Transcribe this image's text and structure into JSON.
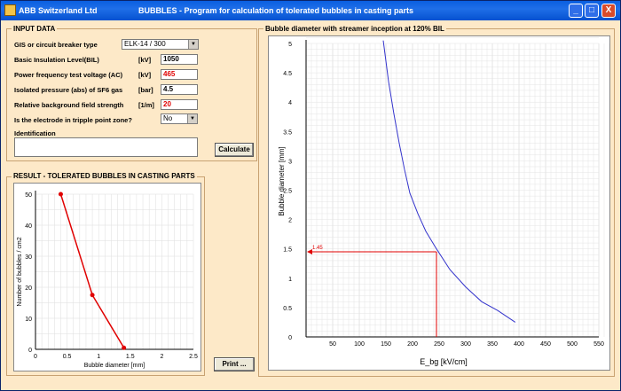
{
  "window": {
    "company": "ABB Switzerland Ltd",
    "title": "BUBBLES - Program for calculation of tolerated bubbles in casting parts",
    "minimize": "_",
    "maximize": "□",
    "close": "X"
  },
  "input": {
    "group_title": "INPUT DATA",
    "gis_label": "GIS or circuit breaker type",
    "gis_value": "ELK-14 / 300",
    "bil_label": "Basic Insulation Level(BIL)",
    "bil_unit": "[kV]",
    "bil_value": "1050",
    "pf_label": "Power frequency test voltage (AC)",
    "pf_unit": "[kV]",
    "pf_value": "465",
    "pres_label": "Isolated pressure (abs) of SF6 gas",
    "pres_unit": "[bar]",
    "pres_value": "4.5",
    "field_label": "Relative background field strength",
    "field_unit": "[1/m]",
    "field_value": "20",
    "tp_label": "Is the electrode in tripple point zone?",
    "tp_value": "No",
    "id_label": "Identification",
    "id_value": "",
    "calculate": "Calculate"
  },
  "result": {
    "group_title": "RESULT - TOLERATED BUBBLES IN CASTING PARTS",
    "print": "Print ..."
  },
  "chart_data": [
    {
      "type": "line",
      "title": "",
      "xlabel": "Bubble diameter [mm]",
      "ylabel": "Number of bubbles / cm2",
      "xlim": [
        0,
        2.5
      ],
      "ylim": [
        0,
        50
      ],
      "xticks": [
        "0",
        "0.5",
        "1",
        "1.5",
        "2",
        "2.5"
      ],
      "yticks": [
        "0",
        "10",
        "20",
        "30",
        "40",
        "50"
      ],
      "series": [
        {
          "x": [
            0.4,
            0.9,
            1.4
          ],
          "y": [
            50,
            17.5,
            0.5
          ],
          "color": "#e00000"
        }
      ]
    },
    {
      "type": "line",
      "title": "Bubble diameter with streamer inception at 120% BIL",
      "xlabel": "E_bg [kV/cm]",
      "ylabel": "Bubble diameter [mm]",
      "xlim": [
        0,
        550
      ],
      "ylim": [
        0,
        5
      ],
      "xticks": [
        "50",
        "100",
        "150",
        "200",
        "250",
        "300",
        "350",
        "400",
        "450",
        "500",
        "550"
      ],
      "yticks": [
        "0",
        "0.5",
        "1",
        "1.5",
        "2",
        "2.5",
        "3",
        "3.5",
        "4",
        "4.5",
        "5"
      ],
      "series": [
        {
          "x": [
            145,
            155,
            165,
            175,
            185,
            195,
            210,
            225,
            245,
            270,
            300,
            330,
            360,
            393
          ],
          "y": [
            5.05,
            4.35,
            3.8,
            3.3,
            2.85,
            2.45,
            2.1,
            1.8,
            1.5,
            1.15,
            0.85,
            0.6,
            0.45,
            0.25
          ],
          "color": "#3333cc"
        }
      ],
      "marker": {
        "x": 245,
        "y": 1.45,
        "label": "1.45",
        "color": "#e00000"
      }
    }
  ]
}
